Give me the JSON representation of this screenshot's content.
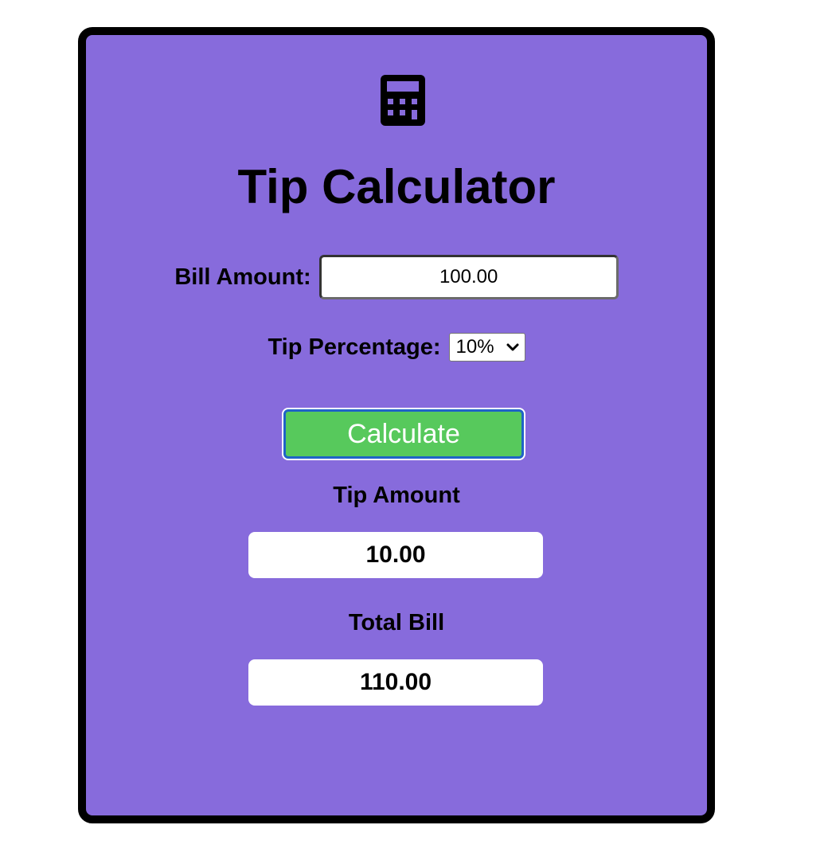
{
  "app": {
    "title": "Tip Calculator",
    "icon": "calculator-icon"
  },
  "bill": {
    "label": "Bill Amount:",
    "value": "100.00"
  },
  "tip": {
    "label": "Tip Percentage:",
    "selected": "10%"
  },
  "calculate_button": {
    "label": "Calculate"
  },
  "results": {
    "tip_amount_label": "Tip Amount",
    "tip_amount_value": "10.00",
    "total_bill_label": "Total Bill",
    "total_bill_value": "110.00"
  },
  "colors": {
    "page_background": "#ffffff",
    "card_background": "#876bdc",
    "card_border": "#000000",
    "button_background": "#57c95c",
    "button_border": "#1f63c7",
    "result_background": "#ffffff"
  }
}
